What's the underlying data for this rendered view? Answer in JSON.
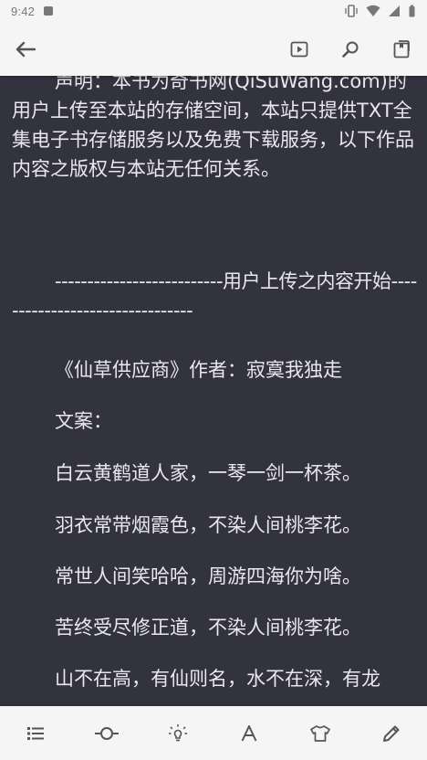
{
  "status_bar": {
    "time": "9:42"
  },
  "content": {
    "paragraphs": [
      "声明：本书为奇书网(QiSuWang.com)的用户上传至本站的存储空间，本站只提供TXT全集电子书存储服务以及免费下载服务，以下作品内容之版权与本站无任何关系。",
      "--------------------------用户上传之内容开始--------------------------------",
      "《仙草供应商》作者：寂寞我独走",
      "文案：",
      "白云黄鹤道人家，一琴一剑一杯茶。",
      "羽衣常带烟霞色，不染人间桃李花。",
      "常世人间笑哈哈，周游四海你为啥。",
      "苦终受尽修正道，不染人间桃李花。",
      "山不在高，有仙则名，水不在深，有龙"
    ]
  },
  "icons": {
    "back": "arrow-back-icon",
    "play": "play-icon",
    "search": "search-icon",
    "bookmark": "bookmark-icon",
    "catalog": "list-icon",
    "progress": "progress-icon",
    "brightness": "lightbulb-icon",
    "font": "font-icon",
    "theme": "shirt-icon",
    "edit": "pencil-icon"
  },
  "colors": {
    "background": "#33323f",
    "text": "#e8e8ee",
    "bars": "#f5f5f5"
  }
}
